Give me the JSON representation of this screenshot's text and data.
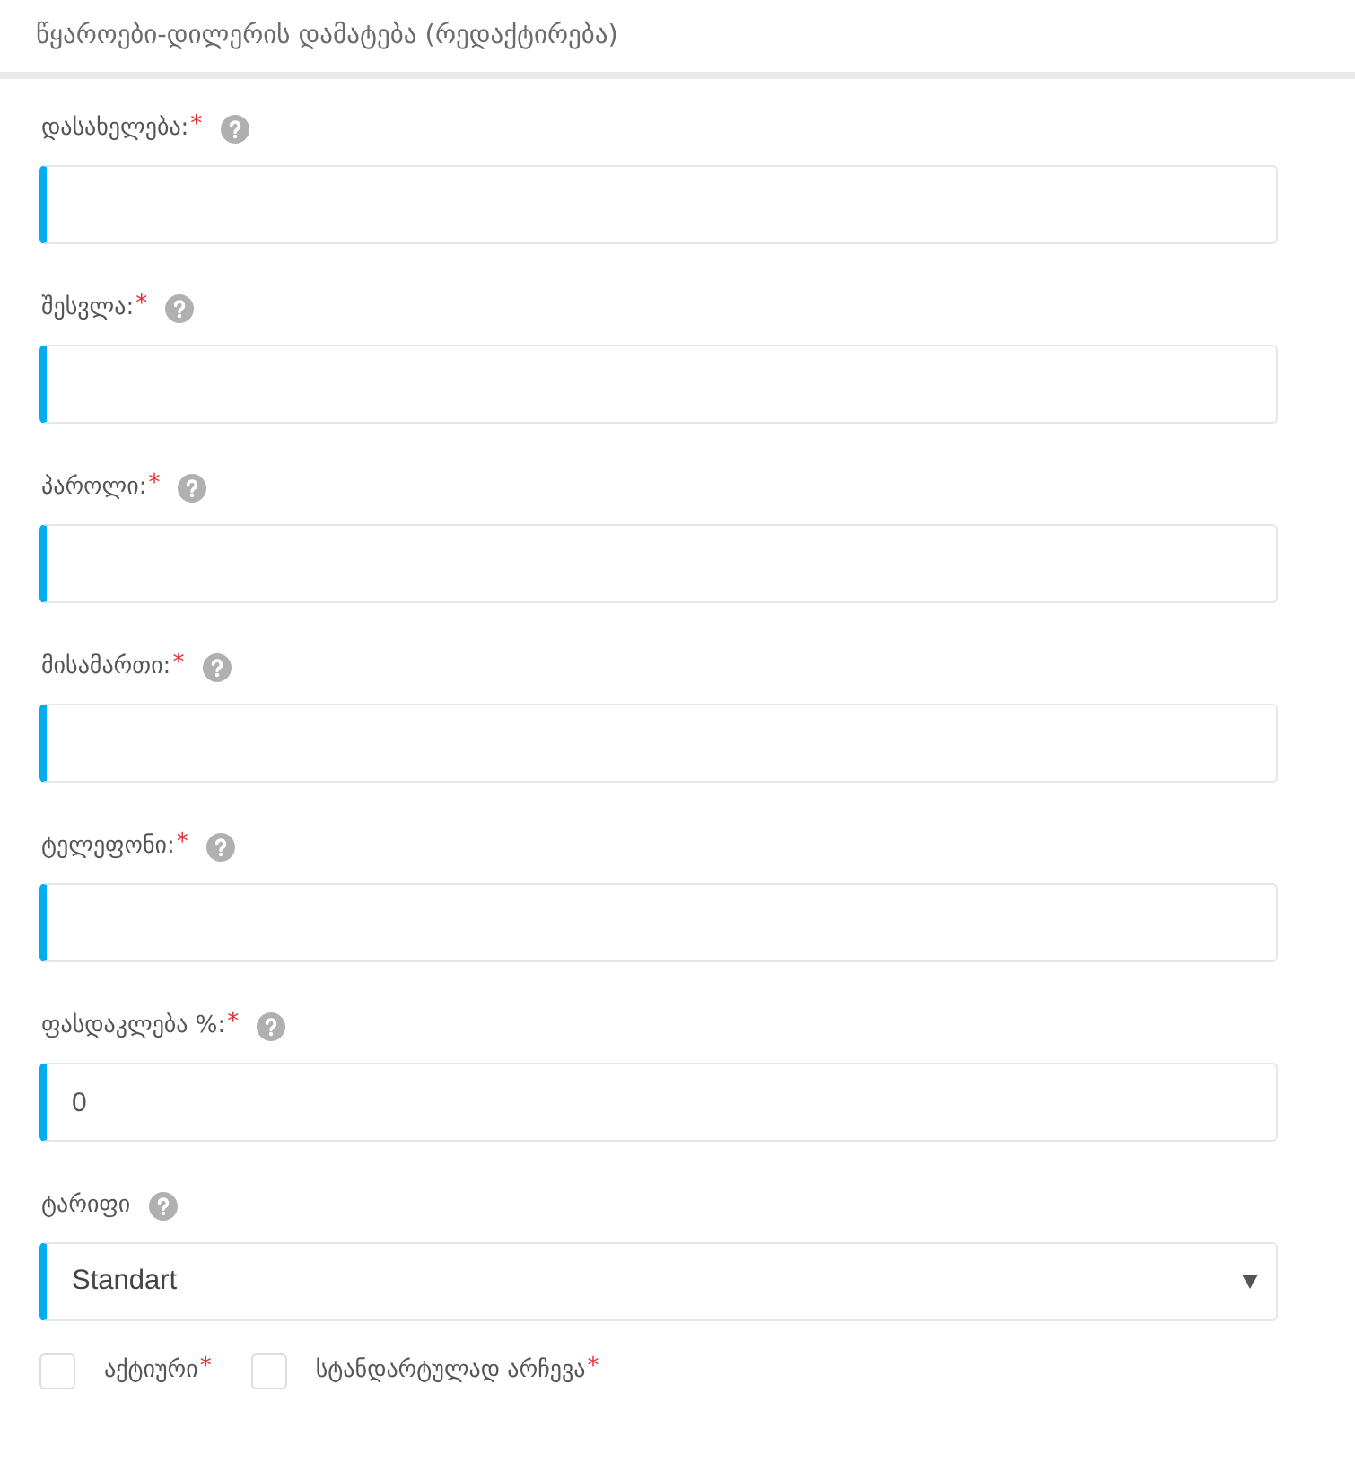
{
  "header": {
    "title": "წყაროები-დილერის დამატება (რედაქტირება)"
  },
  "fields": [
    {
      "kind": "text",
      "label": "დასახელება:",
      "asterisk": "*",
      "help": true
    },
    {
      "kind": "text",
      "label": "შესვლა:",
      "asterisk": "*",
      "help": true
    },
    {
      "kind": "text",
      "label": "პაროლი:",
      "asterisk": "*",
      "help": true
    },
    {
      "kind": "text",
      "label": "მისამართი:",
      "asterisk": "*",
      "help": true
    },
    {
      "kind": "text",
      "label": "ტელეფონი:",
      "asterisk": "*",
      "help": true
    },
    {
      "kind": "text",
      "label": "ფასდაკლება %:",
      "asterisk": "*",
      "help": true,
      "value": "0"
    },
    {
      "kind": "select",
      "label": "ტარიფი",
      "help": true,
      "value": "Standart"
    }
  ],
  "checkboxes": [
    {
      "label": "აქტიური",
      "asterisk": "*",
      "checked": false
    },
    {
      "label": "სტანდარტულად არჩევა",
      "asterisk": "*",
      "checked": false
    }
  ]
}
